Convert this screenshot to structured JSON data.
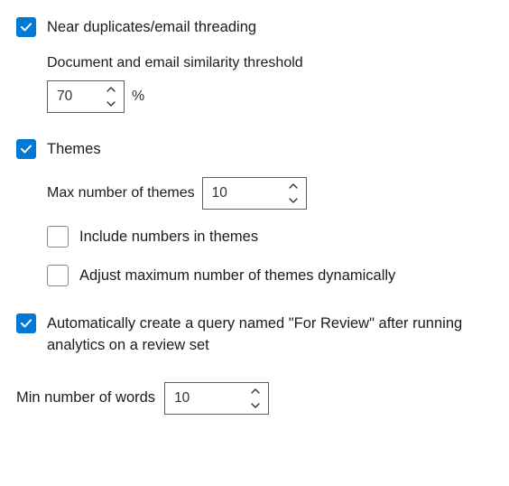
{
  "nearDuplicates": {
    "label": "Near duplicates/email threading",
    "checked": true,
    "thresholdLabel": "Document and email similarity threshold",
    "thresholdValue": "70",
    "thresholdSuffix": "%"
  },
  "themes": {
    "label": "Themes",
    "checked": true,
    "maxThemesLabel": "Max number of themes",
    "maxThemesValue": "10",
    "includeNumbers": {
      "label": "Include numbers in themes",
      "checked": false
    },
    "adjustDynamic": {
      "label": "Adjust maximum number of themes dynamically",
      "checked": false
    }
  },
  "autoQuery": {
    "label": "Automatically create a query named \"For Review\" after running analytics on a review set",
    "checked": true
  },
  "minWords": {
    "label": "Min number of words",
    "value": "10"
  }
}
